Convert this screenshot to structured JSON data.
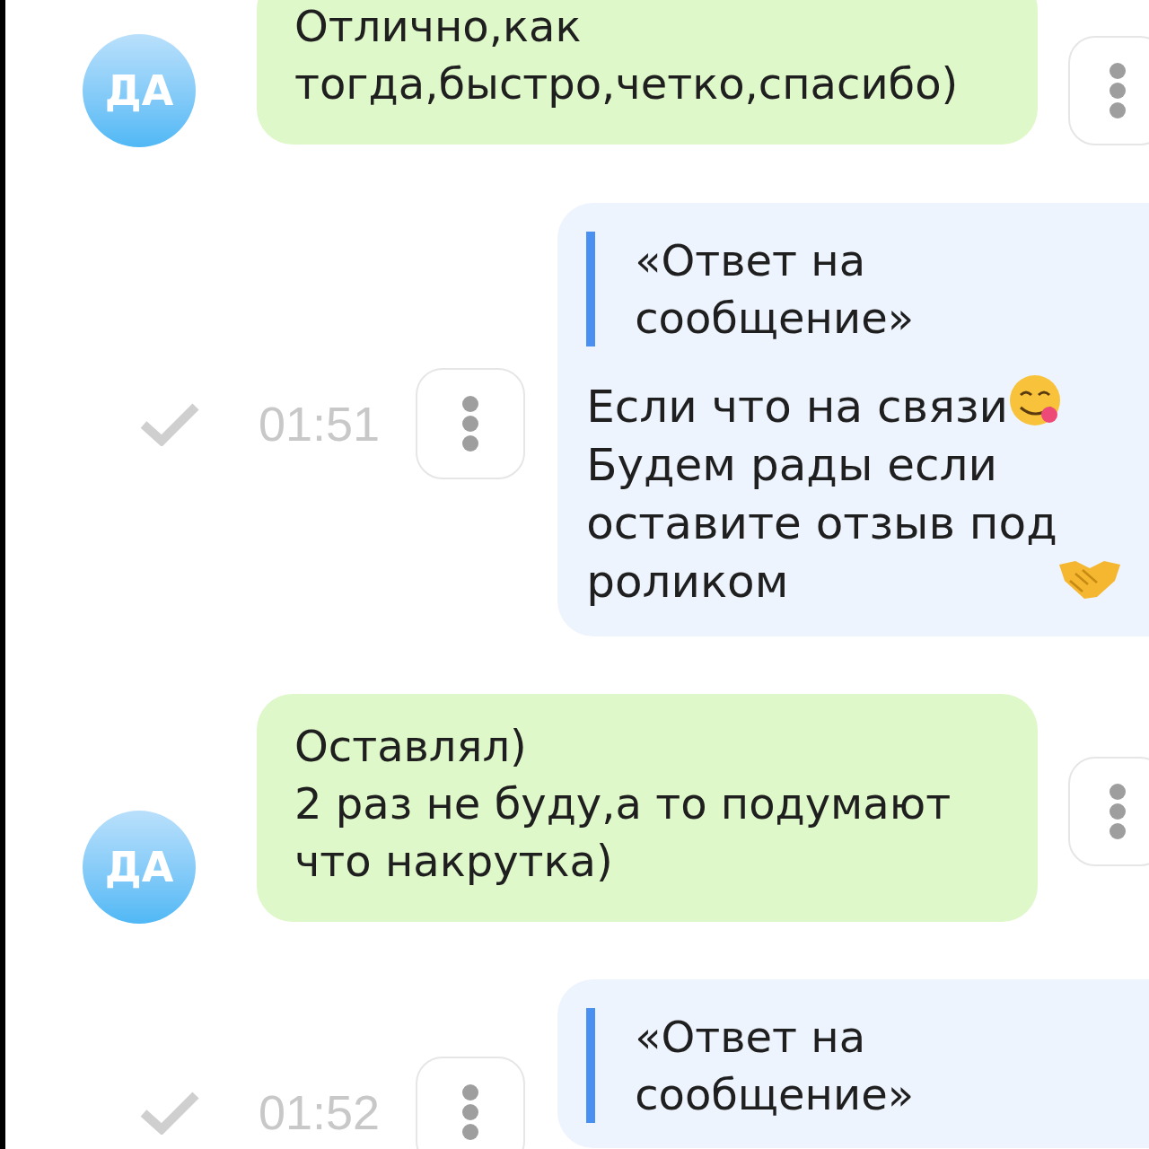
{
  "messages": [
    {
      "kind": "incoming",
      "avatar": "ДА",
      "segments": [
        {
          "text": "Отлично,как\nтогда,быстро,четко,спасибо)"
        }
      ]
    },
    {
      "kind": "outgoing",
      "delivered": true,
      "time": "01:51",
      "quote": "«Ответ на\nсообщение»",
      "segments": [
        {
          "text": "Если что на связи"
        },
        {
          "text": "Будем рады если\nоставите отзыв под\nроликом"
        }
      ]
    },
    {
      "kind": "incoming",
      "avatar": "ДА",
      "segments": [
        {
          "text": "Оставлял)\n2 раз не буду,а то подумают\nчто накрутка)"
        }
      ]
    },
    {
      "kind": "outgoing",
      "delivered": true,
      "time": "01:52",
      "quote": "«Ответ на\nсообщение»"
    }
  ]
}
